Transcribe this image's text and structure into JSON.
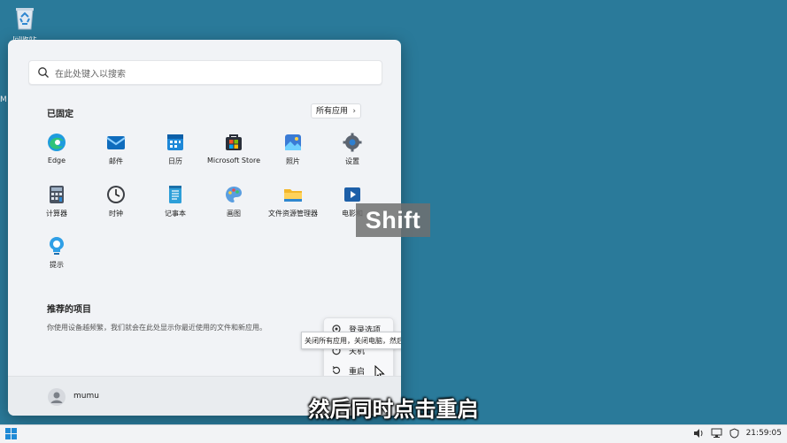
{
  "desktop": {
    "recycle_bin_label": "回收站",
    "edge_mark": "M"
  },
  "search": {
    "placeholder": "在此处键入以搜索"
  },
  "pinned": {
    "title": "已固定",
    "all_apps_label": "所有应用",
    "apps": [
      {
        "label": "Edge",
        "icon": "edge-icon"
      },
      {
        "label": "邮件",
        "icon": "mail-icon"
      },
      {
        "label": "日历",
        "icon": "calendar-icon"
      },
      {
        "label": "Microsoft Store",
        "icon": "store-icon"
      },
      {
        "label": "照片",
        "icon": "photos-icon"
      },
      {
        "label": "设置",
        "icon": "gear-icon"
      },
      {
        "label": "计算器",
        "icon": "calculator-icon"
      },
      {
        "label": "时钟",
        "icon": "clock-icon"
      },
      {
        "label": "记事本",
        "icon": "notepad-icon"
      },
      {
        "label": "画图",
        "icon": "paint-icon"
      },
      {
        "label": "文件资源管理器",
        "icon": "folder-icon"
      },
      {
        "label": "电影和",
        "icon": "movies-icon"
      },
      {
        "label": "提示",
        "icon": "tips-icon"
      }
    ]
  },
  "recommended": {
    "title": "推荐的项目",
    "description": "你使用设备越频繁，我们就会在此处显示你最近使用的文件和新应用。"
  },
  "power_menu": {
    "items": [
      {
        "label": "登录选项",
        "icon": "gear-icon"
      },
      {
        "label": "关机",
        "icon": "power-icon"
      },
      {
        "label": "重启",
        "icon": "restart-icon"
      }
    ],
    "tooltip": "关闭所有应用，关闭电脑，然后重新打开电脑。"
  },
  "user": {
    "name": "mumu"
  },
  "overlay": {
    "key_text": "Shift",
    "subtitle": "然后同时点击重启"
  },
  "taskbar": {
    "time": "21:59:05"
  },
  "colors": {
    "desktop": "#2a7a9a",
    "menu_bg": "#f1f3f6",
    "accent": "#0078d4"
  }
}
